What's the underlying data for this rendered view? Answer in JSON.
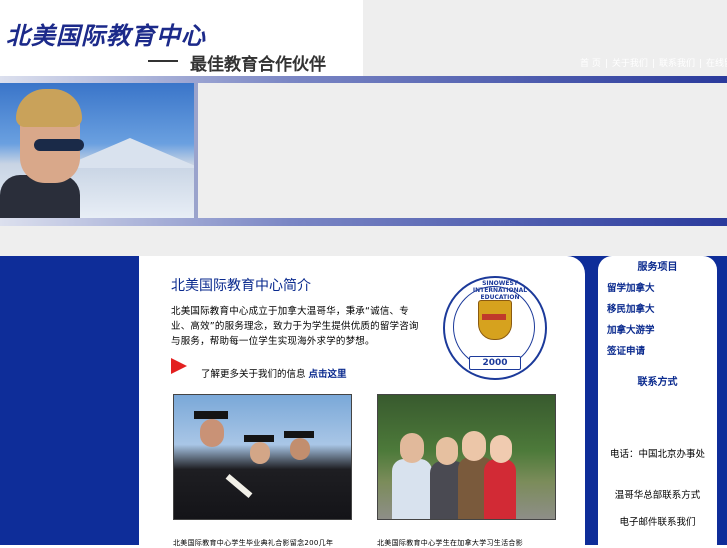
{
  "header": {
    "logo_title": "北美国际教育中心",
    "logo_slogan": "最佳教育合作伙伴",
    "top_glyph": "",
    "nav": [
      "首 页",
      "关于我们",
      "联系我们",
      "在线留言"
    ]
  },
  "main": {
    "corner_glyph": "",
    "title": "北美国际教育中心简介",
    "body": "北美国际教育中心成立于加拿大温哥华，秉承“诚信、专业、高效”的服务理念，致力于为学生提供优质的留学咨询与服务，帮助每一位学生实现海外求学的梦想。",
    "body_glyph": "",
    "more_text": "了解更多关于我们的信息 ",
    "more_link": "点击这里",
    "emblem_arc_text": "SINOWEST INTERNATIONAL EDUCATION",
    "emblem_year": "2000",
    "image_glyphs": [
      "",
      "",
      "",
      "",
      ""
    ],
    "captions": [
      "北美国际教育中心学生毕业典礼合影留念200几年",
      "北美国际教育中心学生在加拿大学习生活合影"
    ]
  },
  "sidebar": {
    "corner_glyph": "",
    "heading_services": "服务项目",
    "links": [
      "留学加拿大",
      "移民加拿大",
      "加拿大游学",
      "签证申请"
    ],
    "heading_contact": "联系方式",
    "contact_lines": [
      "电话：中国北京办事处",
      "温哥华总部联系方式",
      "电子邮件联系我们"
    ]
  },
  "colors": {
    "brand_blue": "#0e2d99",
    "link_blue": "#0a2a8e",
    "accent_red": "#e32020",
    "panel_grey": "#eeeeee"
  },
  "icons": {
    "arrow": "red-arrow-icon",
    "emblem": "school-emblem-icon"
  }
}
